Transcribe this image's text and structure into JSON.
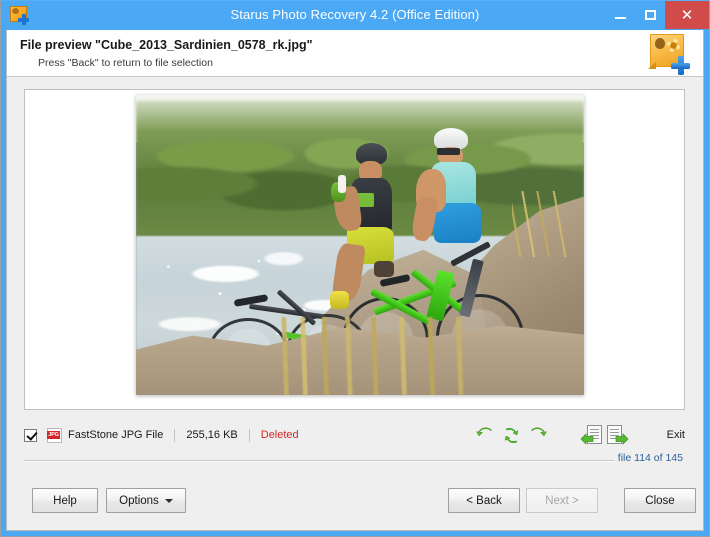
{
  "window": {
    "title": "Starus Photo Recovery 4.2 (Office Edition)",
    "app_icon": "photo-recovery-app-icon",
    "controls": {
      "minimize": "minimize-icon",
      "maximize": "maximize-icon",
      "close": "✕"
    },
    "frame_color": "#4aa8f5",
    "close_button_color": "#d14b4b"
  },
  "header": {
    "title": "File preview \"Cube_2013_Sardinien_0578_rk.jpg\"",
    "subtitle": "Press \"Back\" to return to file selection",
    "logo_icon": "photo-plus-logo-icon"
  },
  "preview": {
    "image_alt": "Two mountain bikers sitting on rocks beside a lake",
    "file_name": "Cube_2013_Sardinien_0578_rk.jpg"
  },
  "info": {
    "checked": true,
    "file_type_icon": "jpg-file-icon",
    "file_type": "FastStone JPG File",
    "file_size": "255,16 KB",
    "state": "Deleted",
    "state_color": "#cf2a2a"
  },
  "tools": {
    "rotate_left": "rotate-left-icon",
    "rotate_flip": "rotate-flip-icon",
    "rotate_right": "rotate-right-icon",
    "prev_file": "previous-file-icon",
    "next_file": "next-file-icon",
    "exit_label": "Exit",
    "icon_color": "#55bb2e"
  },
  "status": {
    "counter": "file 114 of 145",
    "counter_color": "#2b5f9e"
  },
  "buttons": {
    "help": "Help",
    "options": "Options",
    "back": "< Back",
    "next": "Next >",
    "next_disabled": true,
    "close": "Close"
  }
}
